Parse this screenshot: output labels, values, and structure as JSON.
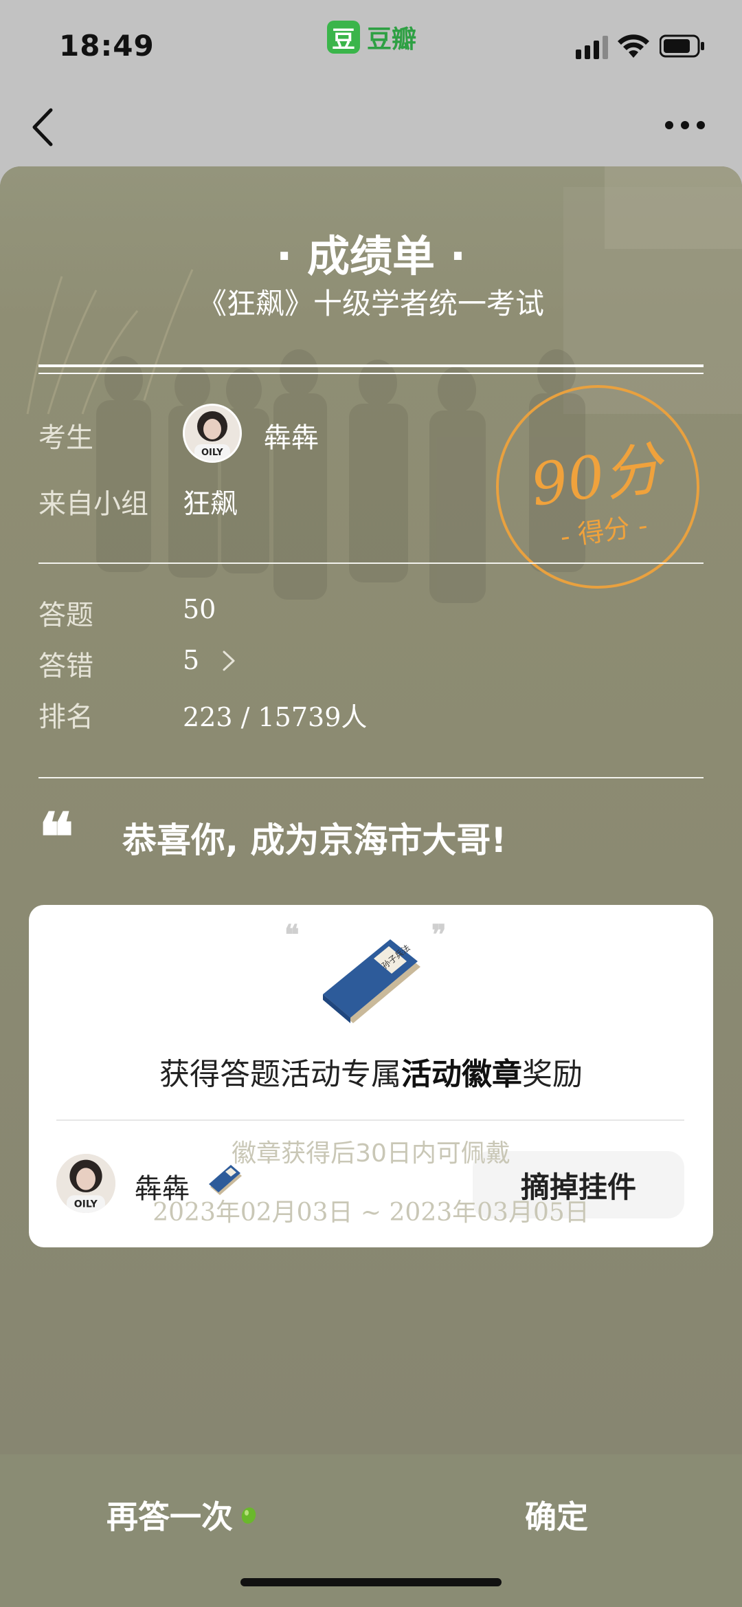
{
  "status_bar": {
    "time": "18:49",
    "app_name": "豆瓣",
    "app_logo_char": "豆"
  },
  "nav": {
    "back_icon": "chevron-left-icon",
    "more_icon": "more-dots-icon"
  },
  "sheet": {
    "title": "· 成绩单 ·",
    "subtitle": "《狂飙》十级学者统一考试",
    "candidate_label": "考生",
    "candidate_name": "犇犇",
    "group_label": "来自小组",
    "group_name": "狂飙",
    "score": "90分",
    "score_label": "- 得分 -",
    "stats": [
      {
        "label": "答题",
        "value": "50"
      },
      {
        "label": "答错",
        "value": "5"
      },
      {
        "label": "排名",
        "value": "223 / 15739人"
      }
    ],
    "quote_mark": "❝",
    "congrats": "恭喜你, 成为京海市大哥!"
  },
  "reward": {
    "text_pre": "获得答题活动专属",
    "text_bold": "活动徽章",
    "text_post": "奖励",
    "badge_book_text": "孙子兵法",
    "user_name": "犇犇",
    "remove_button": "摘掉挂件"
  },
  "notes": {
    "wear_note": "徽章获得后30日内可佩戴",
    "date_range": "2023年02月03日 ~ 2023年03月05日"
  },
  "bottom": {
    "retry_button": "再答一次",
    "confirm_button": "确定"
  },
  "colors": {
    "stamp": "#f0a23c",
    "card_bg": "#8a8a72",
    "bottom_bar": "#8a8c74"
  }
}
